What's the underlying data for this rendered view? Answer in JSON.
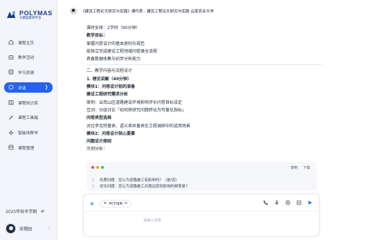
{
  "brand": {
    "name": "POLYMAS",
    "subtitle": "大模型教育平台"
  },
  "nav": [
    {
      "label": "课程主页",
      "icon": "home-icon"
    },
    {
      "label": "教学活动",
      "icon": "activity-icon"
    },
    {
      "label": "学习资源",
      "icon": "resource-icon"
    },
    {
      "label": "对话",
      "icon": "chat-icon",
      "active": true
    },
    {
      "label": "课程知识库",
      "icon": "book-icon"
    },
    {
      "label": "课程工具箱",
      "icon": "toolbox-icon"
    },
    {
      "label": "智能体教学",
      "icon": "agent-icon"
    },
    {
      "label": "课程管理",
      "icon": "manage-icon"
    }
  ],
  "semester": "2025年秋冬学期",
  "user": {
    "name": "张锡园"
  },
  "header": {
    "title": "《建设工程论文研究与实践》课代表 - 建设工程论文研究与实践 云南农业大学"
  },
  "content": [
    {
      "text": "课时安排：2学时（90分钟）",
      "bold": false
    },
    {
      "text": "教学目标：",
      "bold": true
    },
    {
      "text": "掌握问卷设计的基本原则与规范",
      "bold": false
    },
    {
      "text": "能独立完成建设工程领域问卷激全流程",
      "bold": false
    },
    {
      "text": "具备数据收集与初步分析能力",
      "bold": false
    },
    {
      "rule": true
    },
    {
      "text": "二、教学内容与流程设计",
      "bold": false
    },
    {
      "text": "1. 理论讲解（40分钟）",
      "bold": true
    },
    {
      "text": "模块1：问卷设计前的准备",
      "bold": true
    },
    {
      "text": "建设工程研究需求分析",
      "bold": true
    },
    {
      "text": "案例：云南山区道路建设环境影响评价问卷目标设定",
      "bold": false
    },
    {
      "text": "互动：分组讨论「如何将研究问题转化为可量化指标」",
      "bold": false
    },
    {
      "text": "问卷类型选择",
      "bold": true
    },
    {
      "text": "对比李克特量表、语义差异量表在工程调研中的适用场景",
      "bold": false
    },
    {
      "text": "模块2：问卷设计核心要素",
      "bold": true
    },
    {
      "text": "问题设计原则",
      "bold": true
    },
    {
      "text": "示例分析：",
      "bold": false
    }
  ],
  "code": {
    "actions": [
      "复制",
      "下载"
    ],
    "lines": [
      {
        "n": "1",
        "text": "劣质问题：您认为道路施工有影响吗？（是/否）"
      },
      {
        "n": "2",
        "text": "优化问题：您认为道路施工对周边农田影响的频率是？"
      }
    ],
    "dot_colors": [
      "#ef4444",
      "#f59e0b",
      "#22c55e"
    ]
  },
  "composer": {
    "mcp_label": "MCP调用",
    "placeholder": "请输入消息"
  },
  "colors": {
    "accent": "#2563eb",
    "brand": "#1e3a8a"
  }
}
